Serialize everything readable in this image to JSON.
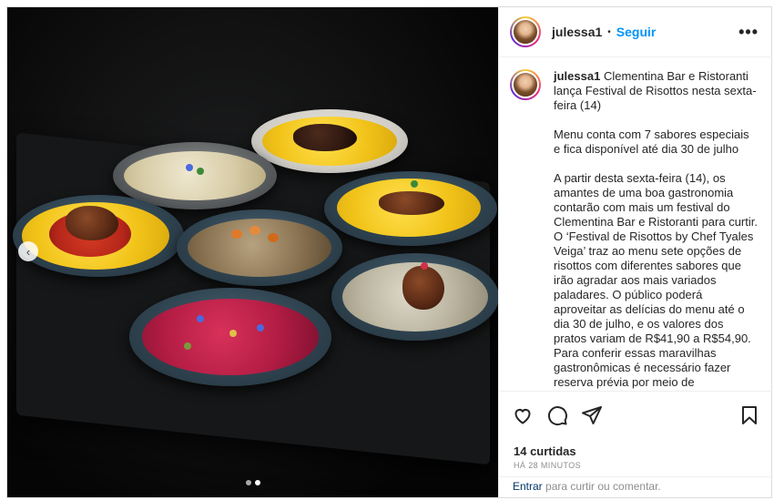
{
  "post": {
    "username": "julessa1",
    "follow_label": "Seguir",
    "separator": "•",
    "more_label": "•••",
    "caption": {
      "username": "julessa1",
      "text": "Clementina Bar e Ristoranti lança Festival de Risottos nesta sexta-feira (14)\n\nMenu conta com 7 sabores especiais e fica disponível até dia 30 de julho\n\nA partir desta sexta-feira (14), os amantes de uma boa gastronomia contarão com mais um festival do Clementina Bar e Ristoranti para curtir. O ‘Festival de Risottos by Chef Tyales Veiga’ traz ao menu sete opções de risottos com diferentes sabores que irão agradar aos mais variados paladares. O público poderá aproveitar as delícias do menu até o dia 30 de julho, e os valores dos pratos variam de R$41,90 a R$54,90. Para conferir essas maravilhas gastronômicas é necessário fazer reserva prévia por meio de"
    },
    "likes_text": "14 curtidas",
    "time_text": "HÁ 28 MINUTOS",
    "comment": {
      "link_label": "Entrar",
      "rest_text": " para curtir ou comentar."
    },
    "media": {
      "prev_arrow": "‹",
      "carousel_total": 2,
      "carousel_active_index": 1
    },
    "icons": [
      "heart-icon",
      "comment-icon",
      "share-icon",
      "bookmark-icon",
      "more-icon",
      "chevron-left-icon"
    ],
    "colors": {
      "link": "#0095f6",
      "muted": "#8e8e8e",
      "dark_link": "#00376b"
    }
  }
}
